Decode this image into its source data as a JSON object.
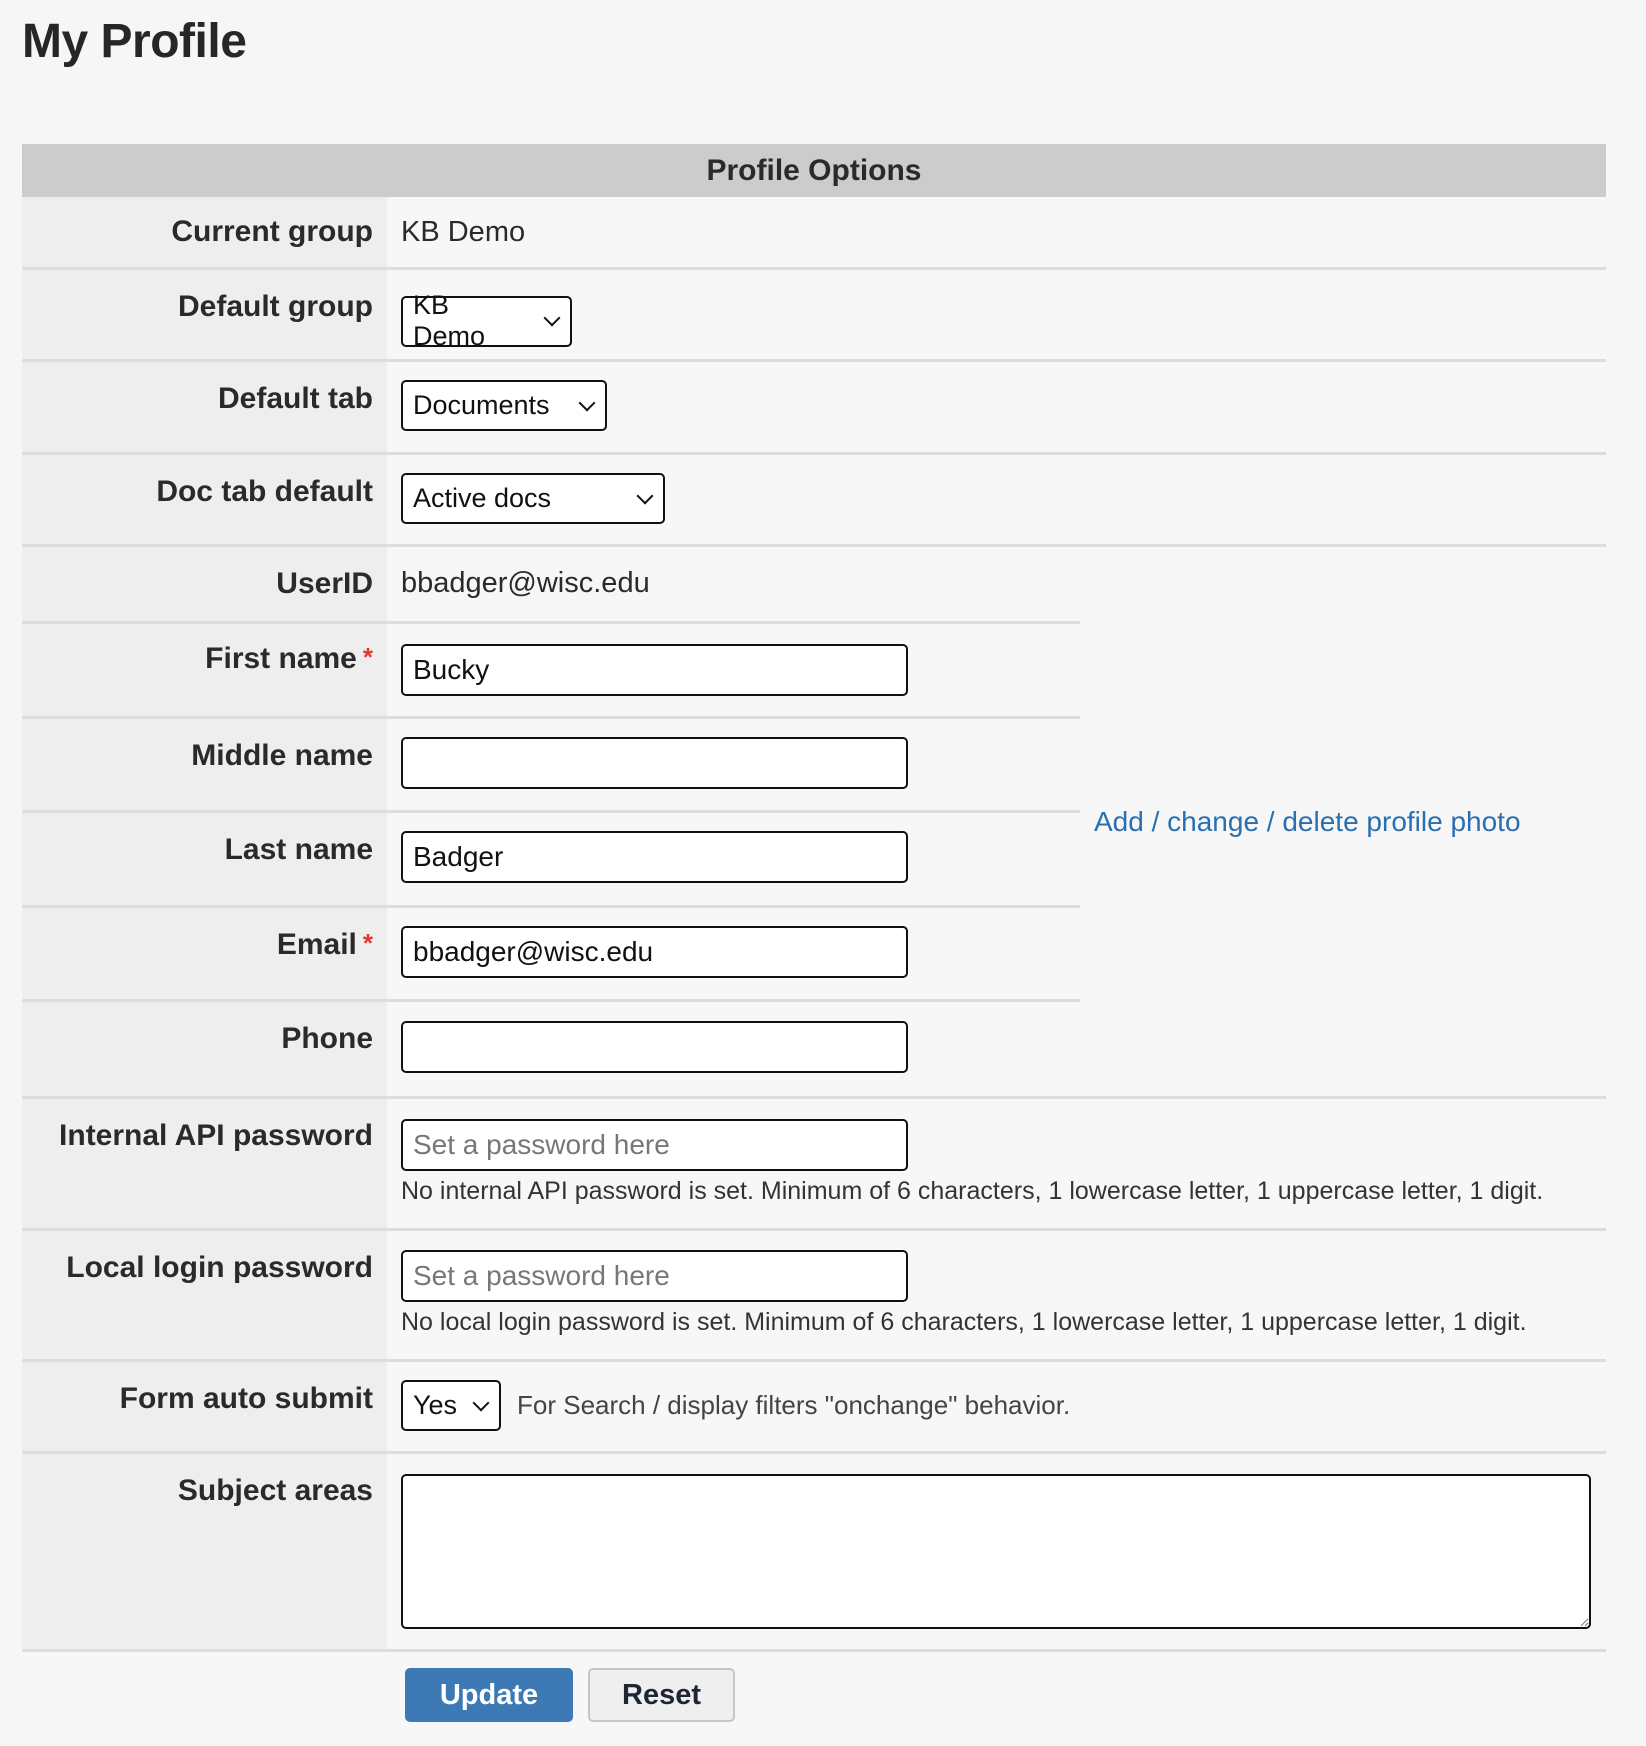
{
  "page_title": "My Profile",
  "table_header": "Profile Options",
  "current_group": {
    "label": "Current group",
    "value": "KB Demo"
  },
  "default_group": {
    "label": "Default group",
    "selected": "KB Demo"
  },
  "default_tab": {
    "label": "Default tab",
    "selected": "Documents"
  },
  "doc_tab_default": {
    "label": "Doc tab default",
    "selected": "Active docs"
  },
  "userid": {
    "label": "UserID",
    "value": "bbadger@wisc.edu"
  },
  "first_name": {
    "label": "First name",
    "required_mark": "*",
    "value": "Bucky"
  },
  "middle_name": {
    "label": "Middle name",
    "value": ""
  },
  "last_name": {
    "label": "Last name",
    "value": "Badger"
  },
  "email": {
    "label": "Email",
    "required_mark": "*",
    "value": "bbadger@wisc.edu"
  },
  "phone": {
    "label": "Phone",
    "value": ""
  },
  "photo_link": "Add / change / delete profile photo",
  "api_password": {
    "label": "Internal API password",
    "placeholder": "Set a password here",
    "hint": "No internal API password is set. Minimum of 6 characters, 1 lowercase letter, 1 uppercase letter, 1 digit."
  },
  "local_password": {
    "label": "Local login password",
    "placeholder": "Set a password here",
    "hint": "No local login password is set. Minimum of 6 characters, 1 lowercase letter, 1 uppercase letter, 1 digit."
  },
  "form_auto_submit": {
    "label": "Form auto submit",
    "selected": "Yes",
    "hint": "For Search / display filters \"onchange\" behavior."
  },
  "subject_areas": {
    "label": "Subject areas",
    "value": ""
  },
  "buttons": {
    "update": "Update",
    "reset": "Reset"
  },
  "colors": {
    "accent": "#3d7ab5",
    "link": "#2a6fb0",
    "required": "#e03a2e",
    "header_bg": "#cccccc"
  }
}
